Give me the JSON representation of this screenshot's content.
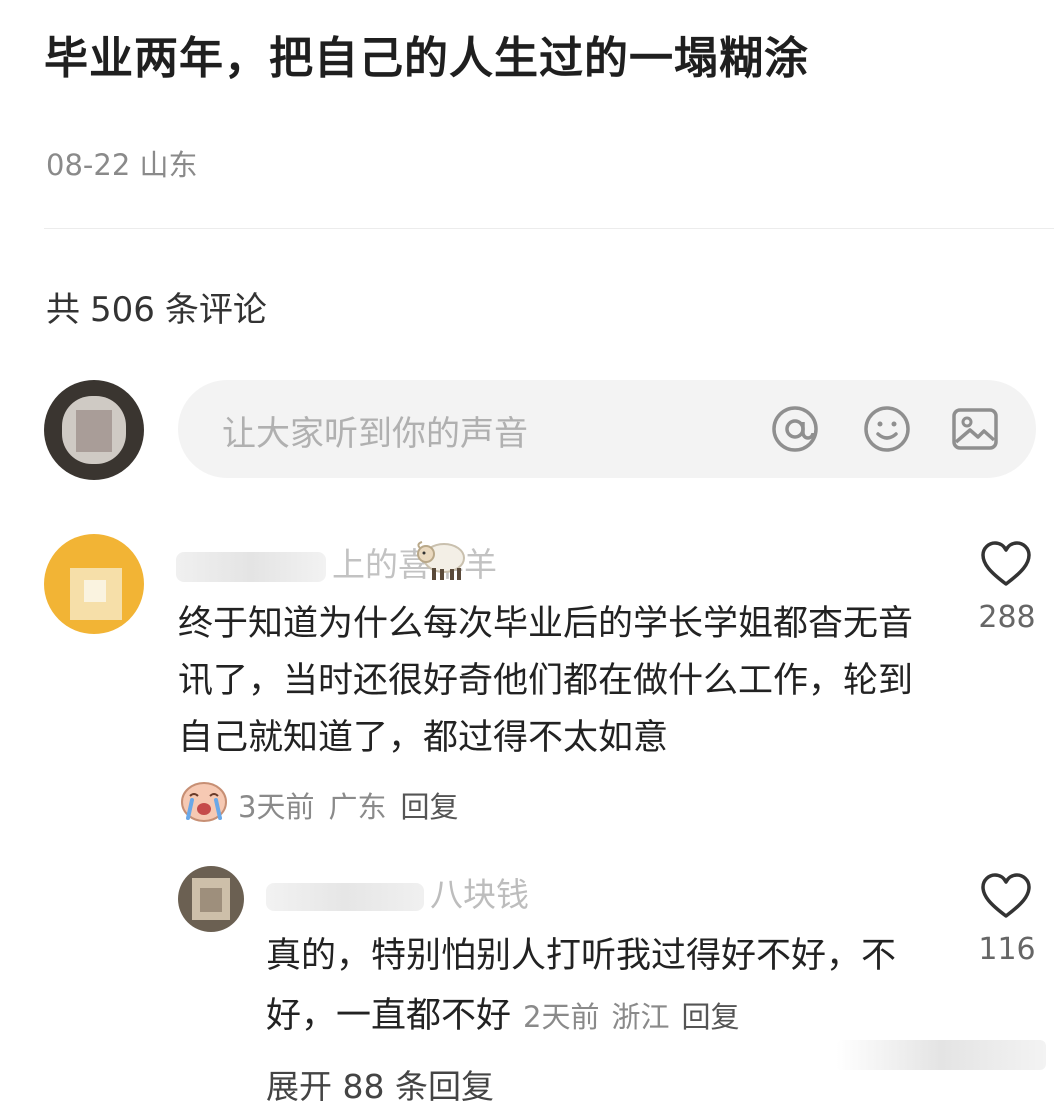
{
  "post": {
    "title": "毕业两年，把自己的人生过的一塌糊涂",
    "date": "08-22",
    "location": "山东"
  },
  "comments_header": {
    "prefix": "共",
    "count": "506",
    "suffix": "条评论"
  },
  "composer": {
    "placeholder": "让大家听到你的声音",
    "icons": [
      "at-icon",
      "emoji-icon",
      "image-icon"
    ]
  },
  "comments": [
    {
      "username_visible": "上的喜羊羊",
      "text": "终于知道为什么每次毕业后的学长学姐都杳无音讯了，当时还很好奇他们都在做什么工作，轮到自己就知道了，都过得不太如意",
      "time": "3天前",
      "location": "广东",
      "reply_label": "回复",
      "likes": "288",
      "reply": {
        "username_visible": "八块钱",
        "text": "真的，特别怕别人打听我过得好不好，不好，一直都不好",
        "time": "2天前",
        "location": "浙江",
        "reply_label": "回复",
        "likes": "116"
      },
      "expand_label": "展开 88 条回复"
    }
  ],
  "colors": {
    "text_primary": "#222222",
    "text_secondary": "#8a8a8a",
    "input_bg": "#f3f3f3",
    "avatar1": "#f2b435"
  }
}
